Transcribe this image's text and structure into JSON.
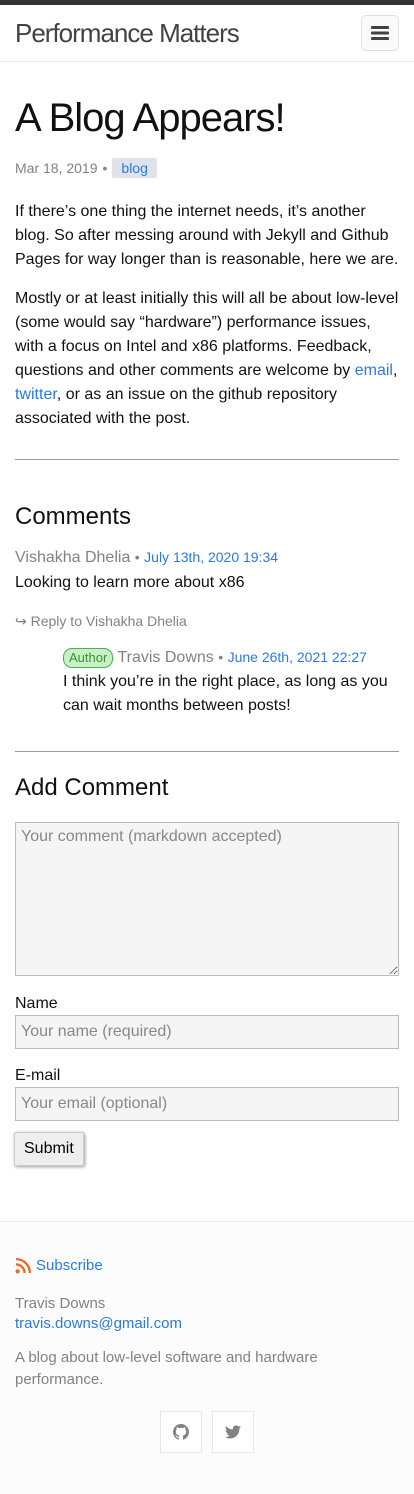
{
  "header": {
    "site_title": "Performance Matters"
  },
  "post": {
    "title": "A Blog Appears!",
    "date": "Mar 18, 2019",
    "bullet": "•",
    "tag": "blog",
    "p1": "If there’s one thing the internet needs, it’s another blog. So after messing around with Jekyll and Github Pages for way longer than is reasonable, here we are.",
    "p2_a": "Mostly or at least initially this will all be about low-level (some would say “hardware”) performance issues, with a focus on Intel and x86 platforms. Feedback, questions and other comments are welcome by ",
    "p2_link1": "email",
    "p2_b": ", ",
    "p2_link2": "twitter",
    "p2_c": ", or as an issue on the github repository associated with the post."
  },
  "comments": {
    "heading": "Comments",
    "items": [
      {
        "author": "Vishakha Dhelia",
        "date": "July 13th, 2020 19:34",
        "body": "Looking to learn more about x86",
        "reply_link": "↪ Reply to Vishakha Dhelia",
        "replies": [
          {
            "badge": "Author",
            "author": "Travis Downs",
            "date": "June 26th, 2021 22:27",
            "body": "I think you’re in the right place, as long as you can wait months between posts!"
          }
        ]
      }
    ]
  },
  "form": {
    "heading": "Add Comment",
    "comment_placeholder": "Your comment (markdown accepted)",
    "name_label": "Name",
    "name_placeholder": "Your name (required)",
    "email_label": "E-mail",
    "email_placeholder": "Your email (optional)",
    "submit_label": "Submit"
  },
  "footer": {
    "subscribe": "Subscribe",
    "name": "Travis Downs",
    "email": "travis.downs@gmail.com",
    "description": "A blog about low-level software and hardware performance.",
    "social": [
      {
        "icon": "github-icon"
      },
      {
        "icon": "twitter-icon"
      }
    ]
  },
  "colors": {
    "link": "#2a7ae2",
    "muted": "#828282",
    "rss": "#f26522",
    "badge_bg": "#c6f2c6",
    "badge_border": "#4caf50"
  }
}
